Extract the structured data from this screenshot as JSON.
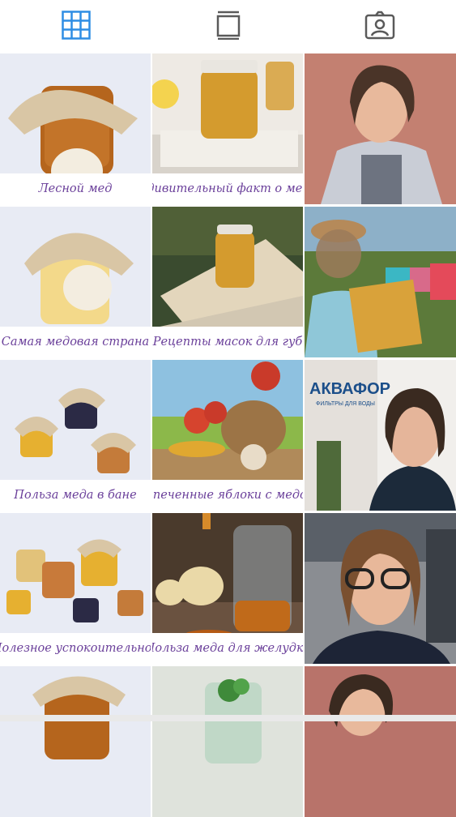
{
  "tabs": [
    {
      "name": "grid-icon",
      "active": true
    },
    {
      "name": "feed-icon",
      "active": false
    },
    {
      "name": "tagged-icon",
      "active": false
    }
  ],
  "colors": {
    "active_tab": "#2f8de4",
    "inactive_tab": "#5a5a5a",
    "caption_text": "#6a3f9a",
    "honey": "#c98a1b"
  },
  "posts": [
    {
      "caption": "Лесной мед",
      "image": "honey jar with paper cover"
    },
    {
      "caption": "Удивительный факт о меде",
      "image": "glass jar of honey on wood"
    },
    {
      "image": "smiling woman outdoors"
    },
    {
      "caption": "Самая медовая страна",
      "image": "jar of cream honey"
    },
    {
      "caption": "Рецепты масок для губ",
      "image": "honey jar on cutting board"
    },
    {
      "image": "beekeeper holding honeycomb frame"
    },
    {
      "caption": "Польза меда в бане",
      "image": "small honey jars"
    },
    {
      "caption": "Запеченные яблоки с медом",
      "image": "apples in basket with honey dipper"
    },
    {
      "image": "woman selfie office",
      "brand": "АКВАФОР",
      "brand_sub": "ФИЛЬТРЫ ДЛЯ ВОДЫ"
    },
    {
      "caption": "Полезное успокоительное",
      "image": "set of honey jars"
    },
    {
      "caption": "Польза меда для желудка",
      "image": "mason jar with honey and dipper"
    },
    {
      "image": "woman with glasses selfie"
    },
    {
      "image": "honey jar partial"
    },
    {
      "image": "glass pitcher with mint"
    },
    {
      "image": "woman partial"
    }
  ]
}
